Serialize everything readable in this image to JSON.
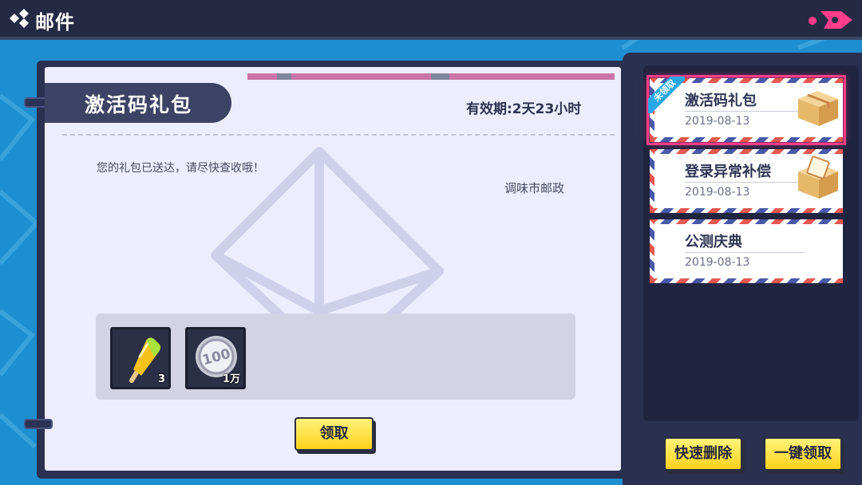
{
  "header": {
    "title": "邮件"
  },
  "mail": {
    "title": "激活码礼包",
    "expiry": "有效期:2天23小时",
    "body": "您的礼包已送达，请尽快查收哦！",
    "sender": "调味市邮政",
    "rewards": [
      {
        "icon": "popsicle-icon",
        "count": "3"
      },
      {
        "icon": "coin-100-icon",
        "count": "1万"
      }
    ],
    "claim_label": "领取"
  },
  "list": {
    "items": [
      {
        "title": "激活码礼包",
        "date": "2019-08-13",
        "badge": "未领取",
        "icon": "box-icon",
        "selected": true
      },
      {
        "title": "登录异常补偿",
        "date": "2019-08-13",
        "icon": "open-box-icon",
        "selected": false
      },
      {
        "title": "公测庆典",
        "date": "2019-08-13",
        "selected": false
      }
    ],
    "delete_label": "快速删除",
    "claim_all_label": "一键领取"
  },
  "colors": {
    "accent": "#ff3d8a",
    "button_yellow": "#ffd21c",
    "panel_dark": "#2a3050",
    "background_blue": "#1d8fd1"
  }
}
